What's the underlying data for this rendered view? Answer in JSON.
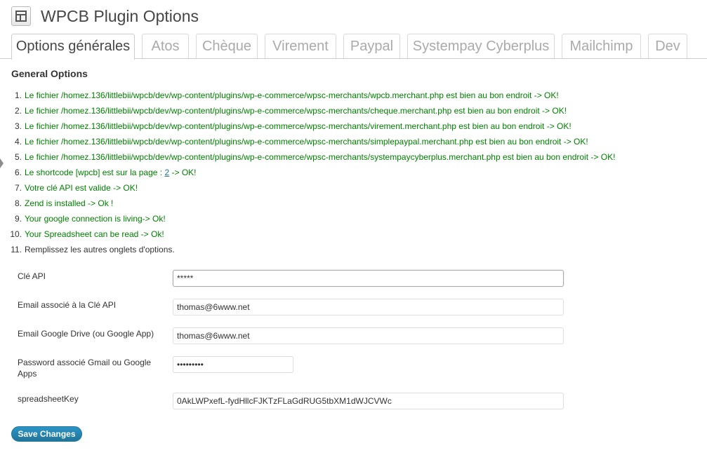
{
  "page": {
    "title": "WPCB Plugin Options"
  },
  "tabs": [
    {
      "label": "Options générales"
    },
    {
      "label": "Atos"
    },
    {
      "label": "Chèque"
    },
    {
      "label": "Virement"
    },
    {
      "label": "Paypal"
    },
    {
      "label": "Systempay Cyberplus"
    },
    {
      "label": "Mailchimp"
    },
    {
      "label": "Dev"
    }
  ],
  "section": {
    "title": "General Options"
  },
  "checks": [
    {
      "num": "1.",
      "text": "Le fichier /homez.136/littlebii/wpcb/dev/wp-content/plugins/wp-e-commerce/wpsc-merchants/wpcb.merchant.php est bien au bon endroit -> OK!"
    },
    {
      "num": "2.",
      "text": "Le fichier /homez.136/littlebii/wpcb/dev/wp-content/plugins/wp-e-commerce/wpsc-merchants/cheque.merchant.php est bien au bon endroit -> OK!"
    },
    {
      "num": "3.",
      "text": "Le fichier /homez.136/littlebii/wpcb/dev/wp-content/plugins/wp-e-commerce/wpsc-merchants/virement.merchant.php est bien au bon endroit -> OK!"
    },
    {
      "num": "4.",
      "text": "Le fichier /homez.136/littlebii/wpcb/dev/wp-content/plugins/wp-e-commerce/wpsc-merchants/simplepaypal.merchant.php est bien au bon endroit -> OK!"
    },
    {
      "num": "5.",
      "text": "Le fichier /homez.136/littlebii/wpcb/dev/wp-content/plugins/wp-e-commerce/wpsc-merchants/systempaycyberplus.merchant.php est bien au bon endroit -> OK!"
    },
    {
      "num": "6.",
      "text_before": "Le shortcode [wpcb] est sur la page : ",
      "link": "2",
      "text_after": " -> OK!"
    },
    {
      "num": "7.",
      "text": "Votre clé API est valide -> OK!"
    },
    {
      "num": "8.",
      "text": "Zend is installed -> Ok !"
    },
    {
      "num": "9.",
      "text": "Your google connection is living-> Ok!"
    },
    {
      "num": "10.",
      "text": "Your Spreadsheet can be read -> Ok!"
    },
    {
      "num": "11.",
      "text": "Remplissez les autres onglets d'options."
    }
  ],
  "form": {
    "api_key": {
      "label": "Clé API",
      "value": "*****"
    },
    "api_email": {
      "label": "Email associé à la Clé API",
      "value": "thomas@6www.net"
    },
    "drive_email": {
      "label": "Email Google Drive (ou Google App)",
      "value": "thomas@6www.net"
    },
    "gmail_password": {
      "label": "Password associé Gmail ou Google Apps",
      "value": "•••••••••"
    },
    "spreadsheet_key": {
      "label": "spreadsheetKey",
      "value": "0AkLWPxefL-fydHllcFJKTzFLaGdRUG5tbXM1dWJCVWc"
    }
  },
  "save_label": "Save Changes",
  "colors": {
    "ok": "#008000",
    "link": "#21759b",
    "button": "#21759b"
  }
}
